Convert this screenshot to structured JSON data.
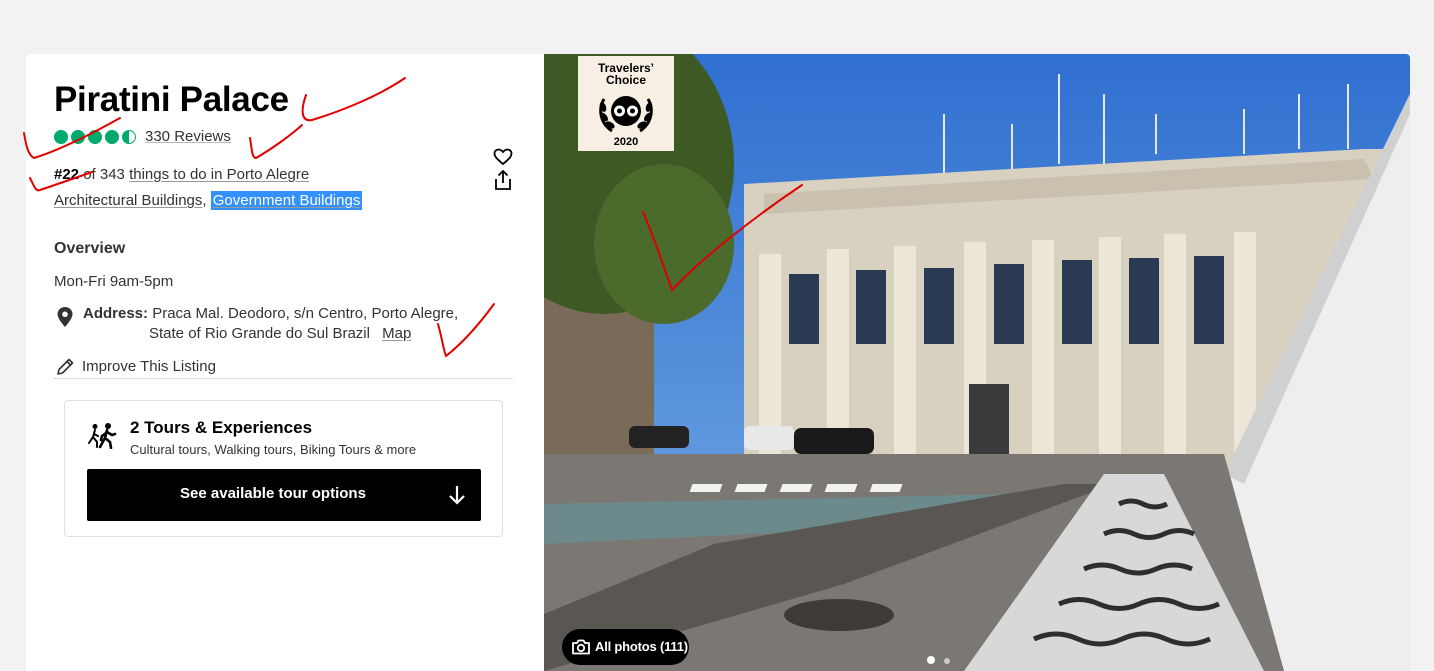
{
  "attraction": {
    "title": "Piratini Palace",
    "rating_bubbles": 4.5,
    "reviews_label": "330 Reviews",
    "rank_number": "#22",
    "rank_of": " of 343 ",
    "rank_link": "things to do in Porto Alegre",
    "category_1": "Architectural Buildings",
    "category_sep": ", ",
    "category_2": "Government Buildings"
  },
  "overview": {
    "heading": "Overview",
    "hours": "Mon-Fri 9am-5pm",
    "address_label": "Address:",
    "address_line1": "Praca Mal. Deodoro, s/n Centro, Porto Alegre,",
    "address_line2": "State of Rio Grande do Sul Brazil",
    "map_link": "Map",
    "improve_label": "Improve This Listing"
  },
  "tours": {
    "title": "2 Tours & Experiences",
    "subtitle": "Cultural tours, Walking tours, Biking Tours & more",
    "button_label": "See available tour options"
  },
  "photo": {
    "badge_title_1": "Travelers’",
    "badge_title_2": "Choice",
    "badge_year": "2020",
    "all_photos_label": "All photos (111)",
    "carousel_position": "1 of 2"
  },
  "icons": {
    "heart": "heart-icon",
    "share": "share-icon",
    "pin": "map-pin-icon",
    "pencil": "pencil-icon",
    "tours": "walking-people-icon",
    "arrow": "arrow-down-icon",
    "camera": "camera-icon"
  },
  "colors": {
    "rating_green": "#00aa6c",
    "selection_blue": "#3390ff",
    "annotation_red": "#e00000"
  }
}
